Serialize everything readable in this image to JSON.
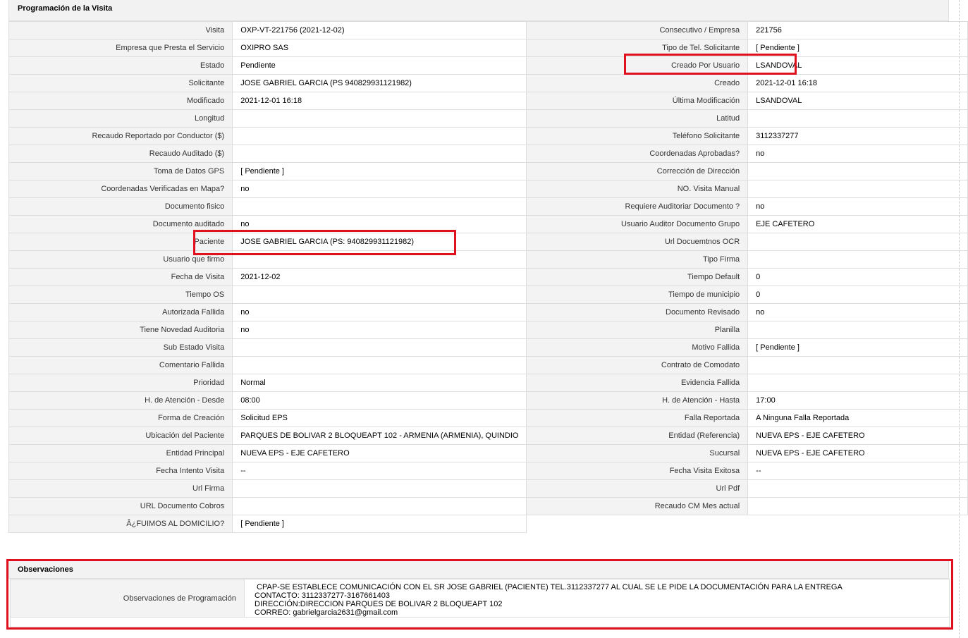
{
  "section_titles": {
    "programacion": "Programación de la Visita",
    "observaciones": "Observaciones"
  },
  "rows": [
    {
      "l1": "Visita",
      "v1": "OXP-VT-221756 (2021-12-02)",
      "l2": "Consecutivo / Empresa",
      "v2": "221756"
    },
    {
      "l1": "Empresa que Presta el Servicio",
      "v1": "OXIPRO SAS",
      "l2": "Tipo de Tel. Solicitante",
      "v2": "[ Pendiente ]"
    },
    {
      "l1": "Estado",
      "v1": "Pendiente",
      "l2": "Creado Por Usuario",
      "v2": "LSANDOVAL"
    },
    {
      "l1": "Solicitante",
      "v1": "JOSE GABRIEL GARCIA (PS 940829931121982)",
      "l2": "Creado",
      "v2": "2021-12-01 16:18"
    },
    {
      "l1": "Modificado",
      "v1": "2021-12-01 16:18",
      "l2": "Última Modificación",
      "v2": " LSANDOVAL"
    },
    {
      "l1": "Longitud",
      "v1": "",
      "l2": "Latitud",
      "v2": ""
    },
    {
      "l1": "Recaudo Reportado por Conductor ($)",
      "v1": "",
      "l2": "Teléfono Solicitante",
      "v2": "3112337277"
    },
    {
      "l1": "Recaudo Auditado ($)",
      "v1": "",
      "l2": "Coordenadas Aprobadas?",
      "v2": " no"
    },
    {
      "l1": "Toma de Datos GPS",
      "v1": "[ Pendiente ]",
      "l2": "Corrección de Dirección",
      "v2": ""
    },
    {
      "l1": "Coordenadas Verificadas en Mapa?",
      "v1": " no",
      "l2": "NO. Visita Manual",
      "v2": ""
    },
    {
      "l1": "Documento fisico",
      "v1": "",
      "l2": "Requiere Auditoriar Documento ?",
      "v2": " no"
    },
    {
      "l1": "Documento auditado",
      "v1": " no",
      "l2": "Usuario Auditor Documento Grupo",
      "v2": "EJE CAFETERO"
    },
    {
      "l1": "Paciente",
      "v1": "JOSE GABRIEL GARCIA (PS: 940829931121982)",
      "l2": "Url Docuemtnos OCR",
      "v2": ""
    },
    {
      "l1": "Usuario que firmo",
      "v1": "",
      "l2": "Tipo Firma",
      "v2": ""
    },
    {
      "l1": "Fecha de Visita",
      "v1": " 2021-12-02",
      "l2": "Tiempo Default",
      "v2": "0"
    },
    {
      "l1": "Tiempo OS",
      "v1": "",
      "l2": "Tiempo de municipio",
      "v2": "0"
    },
    {
      "l1": "Autorizada Fallida",
      "v1": " no",
      "l2": "Documento Revisado",
      "v2": " no"
    },
    {
      "l1": "Tiene Novedad Auditoria",
      "v1": " no",
      "l2": "Planilla",
      "v2": ""
    },
    {
      "l1": "Sub Estado Visita",
      "v1": "",
      "l2": "Motivo Fallida",
      "v2": "[ Pendiente ]"
    },
    {
      "l1": "Comentario Fallida",
      "v1": "",
      "l2": "Contrato de Comodato",
      "v2": ""
    },
    {
      "l1": "Prioridad",
      "v1": "Normal",
      "l2": "Evidencia Fallida",
      "v2": ""
    },
    {
      "l1": "H. de Atención - Desde",
      "v1": "08:00",
      "l2": "H. de Atención - Hasta",
      "v2": "17:00"
    },
    {
      "l1": "Forma de Creación",
      "v1": "Solicitud EPS",
      "l2": "Falla Reportada",
      "v2": "A Ninguna Falla Reportada"
    },
    {
      "l1": "Ubicación del Paciente",
      "v1": "PARQUES DE BOLIVAR 2 BLOQUEAPT 102 - ARMENIA (ARMENIA), QUINDIO",
      "l2": "Entidad (Referencia)",
      "v2": "NUEVA EPS - EJE CAFETERO"
    },
    {
      "l1": "Entidad Principal",
      "v1": "NUEVA EPS - EJE CAFETERO",
      "l2": "Sucursal",
      "v2": "NUEVA EPS - EJE CAFETERO"
    },
    {
      "l1": "Fecha Intento Visita",
      "v1": " --",
      "l2": "Fecha Visita Exitosa",
      "v2": " --"
    },
    {
      "l1": "Url Firma",
      "v1": "",
      "l2": "Url Pdf",
      "v2": ""
    },
    {
      "l1": "URL Documento Cobros",
      "v1": "",
      "l2": "Recaudo CM Mes actual",
      "v2": ""
    },
    {
      "l1": "Â¿FUIMOS AL DOMICILIO?",
      "v1": "[ Pendiente ]"
    }
  ],
  "observaciones": {
    "label": "Observaciones de Programación",
    "lines": [
      " CPAP-SE ESTABLECE COMUNICACIÓN CON EL SR JOSE GABRIEL (PACIENTE) TEL.3112337277 AL CUAL SE LE PIDE LA DOCUMENTACIÓN PARA LA ENTREGA",
      "CONTACTO: 3112337277-3167661403",
      "DIRECCIÓN:DIRECCION PARQUES DE BOLIVAR 2 BLOQUEAPT 102",
      "CORREO: gabrielgarcia2631@gmail.com"
    ]
  },
  "highlight_color": "#e0101e",
  "colors": {
    "label_bg": "#f3f3f3",
    "header_bg": "#f2f2f2",
    "border": "#dddddd"
  }
}
